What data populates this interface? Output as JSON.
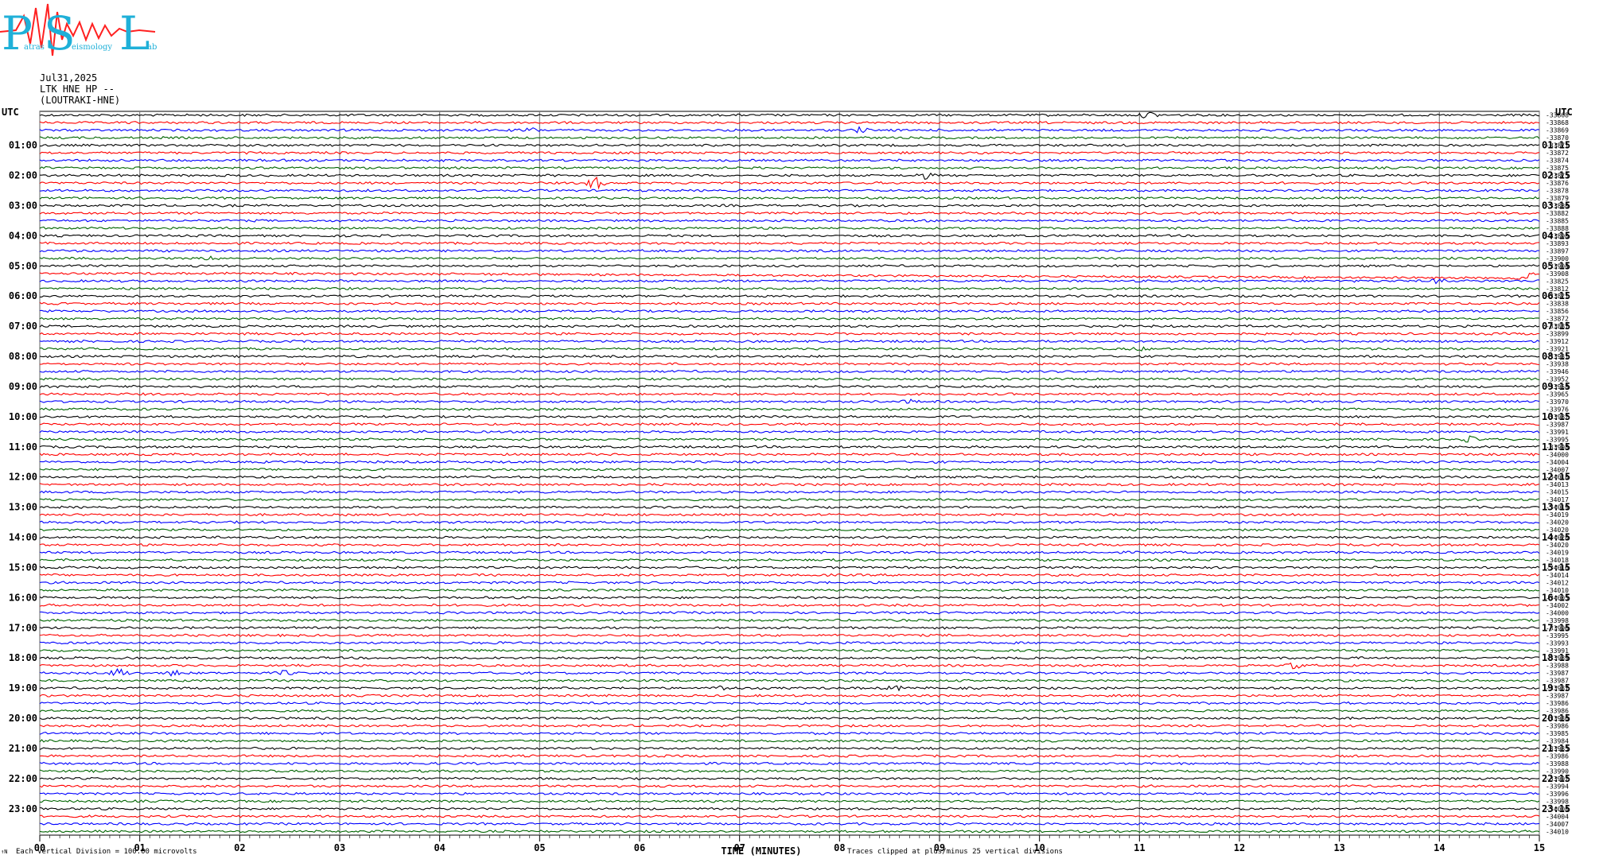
{
  "logo": {
    "big_letters": [
      "P",
      "S",
      "L"
    ],
    "small_words": [
      "atras",
      "eismology",
      "ab"
    ],
    "colors": {
      "letters": "#1fb0d8",
      "wave": "#ff2020"
    }
  },
  "header": {
    "date": "Jul31,2025",
    "station": "LTK HNE HP --",
    "site": "(LOUTRAKI-HNE)"
  },
  "footer": {
    "scale_note": "Each Vertical Division =  100.00 microvolts",
    "corner_mark": "↑N",
    "x_title": "TIME (MINUTES)",
    "clip_note": "Traces clipped at plus/minus 25 vertical divisions"
  },
  "chart_data": {
    "type": "line",
    "title": "",
    "xlabel": "TIME (MINUTES)",
    "ylabel": "UTC",
    "xlim": [
      0,
      15
    ],
    "x_ticks": [
      "00",
      "01",
      "02",
      "03",
      "04",
      "05",
      "06",
      "07",
      "08",
      "09",
      "10",
      "11",
      "12",
      "13",
      "14",
      "15"
    ],
    "left_axis_label": "UTC",
    "right_axis_label": "UTC",
    "left_hours": [
      "01:00",
      "02:00",
      "03:00",
      "04:00",
      "05:00",
      "06:00",
      "07:00",
      "08:00",
      "09:00",
      "10:00",
      "11:00",
      "12:00",
      "13:00",
      "14:00",
      "15:00",
      "16:00",
      "17:00",
      "18:00",
      "19:00",
      "20:00",
      "21:00",
      "22:00",
      "23:00"
    ],
    "right_hours": [
      "01:15",
      "02:15",
      "03:15",
      "04:15",
      "05:15",
      "06:15",
      "07:15",
      "08:15",
      "09:15",
      "10:15",
      "11:15",
      "12:15",
      "13:15",
      "14:15",
      "15:15",
      "16:15",
      "17:15",
      "18:15",
      "19:15",
      "20:15",
      "21:15",
      "22:15",
      "23:15"
    ],
    "trace_colors": [
      "#000000",
      "#ff0000",
      "#0000ff",
      "#006400"
    ],
    "trace_count": 96,
    "trace_offsets": [
      "-33868",
      "-33868",
      "-33869",
      "-33870",
      "-33871",
      "-33872",
      "-33874",
      "-33875",
      "-33875",
      "-33876",
      "-33878",
      "-33879",
      "-33880",
      "-33882",
      "-33885",
      "-33888",
      "-33890",
      "-33893",
      "-33897",
      "-33900",
      "-33904",
      "-33908",
      "-33825",
      "-33812",
      "-33821",
      "-33838",
      "-33856",
      "-33872",
      "-33887",
      "-33899",
      "-33912",
      "-33921",
      "-33931",
      "-33938",
      "-33946",
      "-33952",
      "-33958",
      "-33965",
      "-33970",
      "-33976",
      "-33982",
      "-33987",
      "-33991",
      "-33995",
      "-33998",
      "-34000",
      "-34004",
      "-34007",
      "-34010",
      "-34013",
      "-34015",
      "-34017",
      "-34019",
      "-34019",
      "-34020",
      "-34020",
      "-34020",
      "-34020",
      "-34019",
      "-34018",
      "-34016",
      "-34014",
      "-34012",
      "-34010",
      "-34005",
      "-34002",
      "-34000",
      "-33998",
      "-33996",
      "-33995",
      "-33993",
      "-33991",
      "-33989",
      "-33988",
      "-33987",
      "-33987",
      "-33987",
      "-33987",
      "-33986",
      "-33986",
      "-33986",
      "-33986",
      "-33985",
      "-33984",
      "-33985",
      "-33986",
      "-33988",
      "-33990",
      "-33992",
      "-33994",
      "-33996",
      "-33998",
      "-34000",
      "-34004",
      "-34007",
      "-34010"
    ],
    "events": [
      {
        "trace": 0,
        "minute": 11.1,
        "amp": 4
      },
      {
        "trace": 2,
        "minute": 4.9,
        "amp": 3
      },
      {
        "trace": 2,
        "minute": 8.2,
        "amp": 3
      },
      {
        "trace": 8,
        "minute": 8.85,
        "amp": 4
      },
      {
        "trace": 9,
        "minute": 5.55,
        "amp": 8
      },
      {
        "trace": 19,
        "minute": 1.7,
        "amp": 2
      },
      {
        "trace": 22,
        "minute": 14.0,
        "amp": 3
      },
      {
        "trace": 31,
        "minute": 11.0,
        "amp": 2
      },
      {
        "trace": 38,
        "minute": 8.7,
        "amp": 2
      },
      {
        "trace": 43,
        "minute": 14.3,
        "amp": 3
      },
      {
        "trace": 74,
        "minute": 0.8,
        "amp": 6
      },
      {
        "trace": 74,
        "minute": 1.35,
        "amp": 4
      },
      {
        "trace": 74,
        "minute": 2.45,
        "amp": 3
      },
      {
        "trace": 73,
        "minute": 12.55,
        "amp": 4
      },
      {
        "trace": 76,
        "minute": 6.85,
        "amp": 3
      },
      {
        "trace": 76,
        "minute": 8.55,
        "amp": 3
      }
    ],
    "drift": {
      "trace": 21,
      "from_minute": 2.5,
      "to_minute": 14.9,
      "amp": 6
    },
    "grid": true
  }
}
